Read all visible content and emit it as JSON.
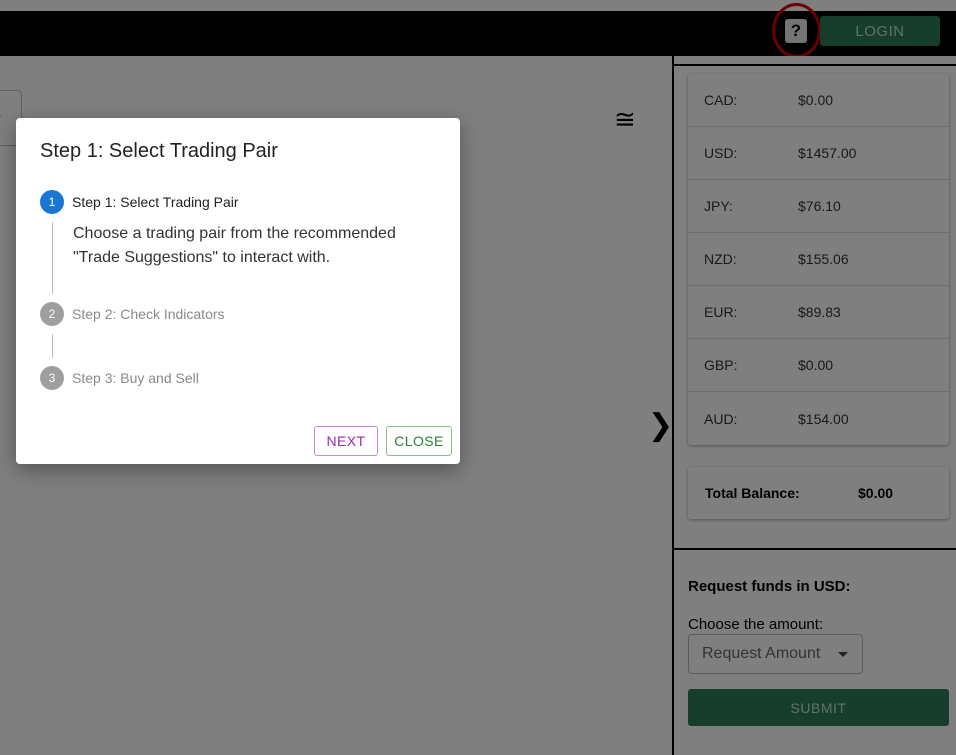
{
  "header": {
    "help_label": "?",
    "login_label": "LOGIN"
  },
  "main": {
    "menu_icon": "menu-icon",
    "expand_icon": "chevron-right-icon"
  },
  "balances": [
    {
      "code": "CAD:",
      "amount": "$0.00"
    },
    {
      "code": "USD:",
      "amount": "$1457.00"
    },
    {
      "code": "JPY:",
      "amount": "$76.10"
    },
    {
      "code": "NZD:",
      "amount": "$155.06"
    },
    {
      "code": "EUR:",
      "amount": "$89.83"
    },
    {
      "code": "GBP:",
      "amount": "$0.00"
    },
    {
      "code": "AUD:",
      "amount": "$154.00"
    }
  ],
  "total": {
    "label": "Total Balance:",
    "amount": "$0.00"
  },
  "request": {
    "title": "Request funds in USD:",
    "subtitle": "Choose the amount:",
    "select_value": "Request Amount",
    "submit_label": "SUBMIT"
  },
  "dialog": {
    "title": "Step 1: Select Trading Pair",
    "steps": [
      {
        "number": "1",
        "label": "Step 1: Select Trading Pair"
      },
      {
        "number": "2",
        "label": "Step 2: Check Indicators"
      },
      {
        "number": "3",
        "label": "Step 3: Buy and Sell"
      }
    ],
    "content": "Choose a trading pair from the recommended \"Trade Suggestions\" to interact with.",
    "next_label": "NEXT",
    "close_label": "CLOSE"
  },
  "colors": {
    "brand_green": "#2e7d5a",
    "active_step": "#1976d2",
    "highlight_ring": "#d80000"
  }
}
